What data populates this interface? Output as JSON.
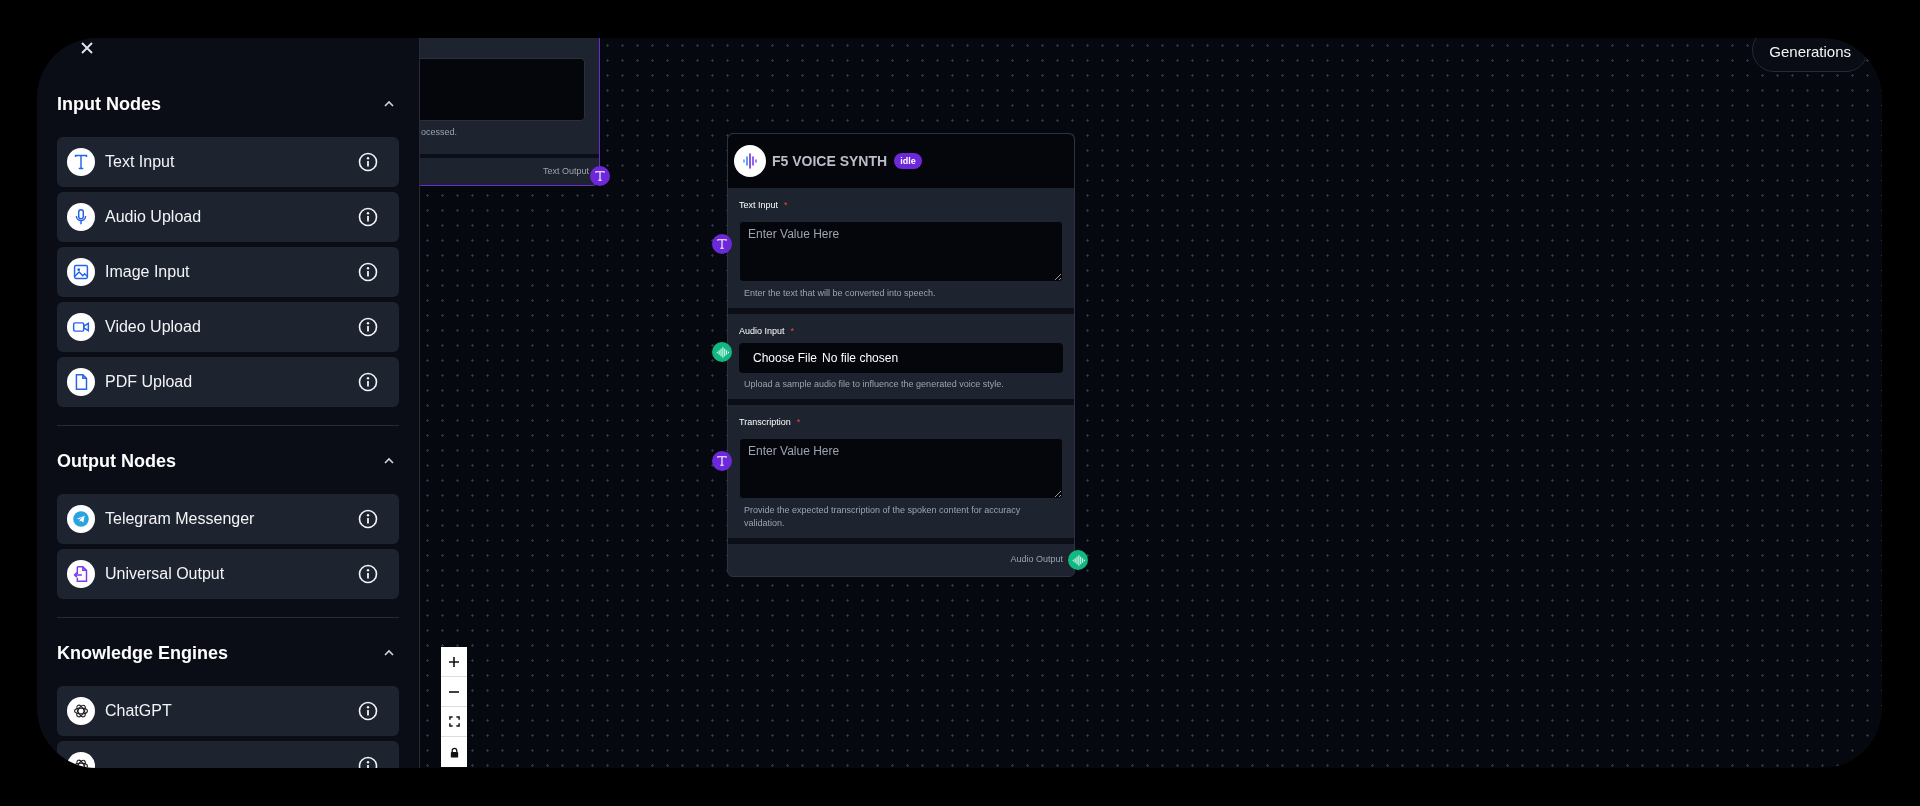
{
  "sidebar": {
    "sections": [
      {
        "title": "Input Nodes",
        "expanded": true,
        "items": [
          {
            "label": "Text Input",
            "kind": "text"
          },
          {
            "label": "Audio Upload",
            "kind": "mic"
          },
          {
            "label": "Image Input",
            "kind": "image"
          },
          {
            "label": "Video Upload",
            "kind": "video"
          },
          {
            "label": "PDF Upload",
            "kind": "file"
          }
        ]
      },
      {
        "title": "Output Nodes",
        "expanded": true,
        "items": [
          {
            "label": "Telegram Messenger",
            "kind": "telegram"
          },
          {
            "label": "Universal Output",
            "kind": "output"
          }
        ]
      },
      {
        "title": "Knowledge Engines",
        "expanded": true,
        "items": [
          {
            "label": "ChatGPT",
            "kind": "knot"
          },
          {
            "kind": "knot"
          }
        ]
      }
    ]
  },
  "canvas": {
    "generations_button": "Generations",
    "partial_node": {
      "description": "ocessed.",
      "output": {
        "label": "Text Output",
        "port": {
          "kind": "text"
        }
      }
    },
    "node": {
      "title": "F5 VOICE SYNTH",
      "status": "idle",
      "fields": [
        {
          "kind": "textarea",
          "label": "Text Input",
          "required_mark": "*",
          "placeholder": "Enter Value Here",
          "help": "Enter the text that will be converted into speech.",
          "port": {
            "kind": "text"
          }
        },
        {
          "kind": "file",
          "label": "Audio Input",
          "required_mark": "*",
          "button": "Choose File",
          "value": "No file chosen",
          "help": "Upload a sample audio file to influence the generated voice style.",
          "port": {
            "kind": "audio"
          }
        },
        {
          "kind": "textarea",
          "label": "Transcription",
          "required_mark": "*",
          "placeholder": "Enter Value Here",
          "help": "Provide the expected transcription of the spoken content for accuracy validation.",
          "port": {
            "kind": "text"
          }
        }
      ],
      "output": {
        "label": "Audio Output",
        "port": {
          "kind": "audio"
        }
      }
    }
  }
}
